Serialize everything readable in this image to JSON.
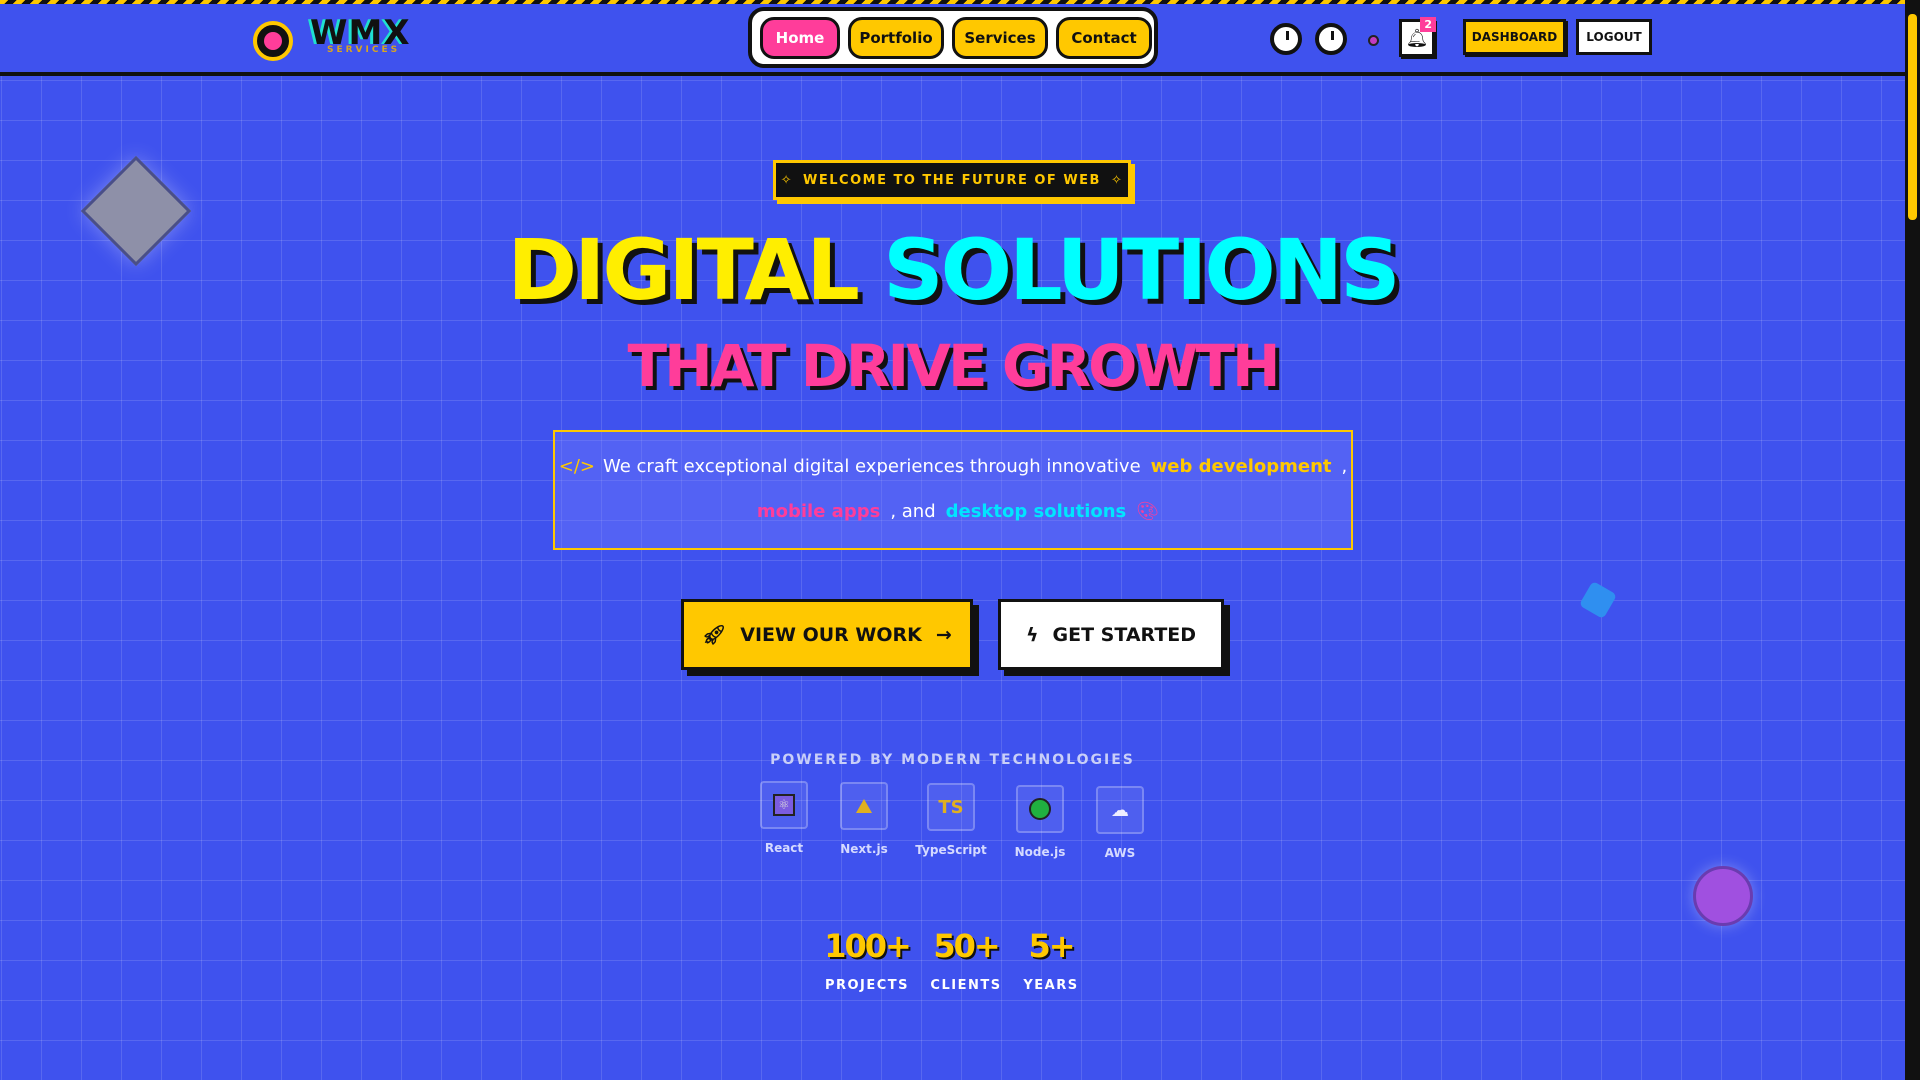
{
  "nav": {
    "logo": "WMX",
    "logo_sub": "SERVICES",
    "links": [
      "Home",
      "Portfolio",
      "Services",
      "Contact"
    ],
    "active": "Home",
    "notifications": "2",
    "dashboard": "DASHBOARD",
    "logout": "LOGOUT"
  },
  "hero": {
    "badge": "WELCOME TO THE FUTURE OF WEB",
    "title_1": "DIGITAL",
    "title_2": "SOLUTIONS",
    "subtitle": "THAT DRIVE GROWTH",
    "desc_pre": "We craft exceptional digital experiences through innovative",
    "desc_h1": "web development",
    "desc_comma": ",",
    "desc_h2": "mobile apps",
    "desc_and": ", and",
    "desc_h3": "desktop solutions",
    "btn_primary": "VIEW OUR WORK",
    "btn_secondary": "GET STARTED"
  },
  "tech": {
    "heading": "POWERED BY MODERN TECHNOLOGIES",
    "items": [
      {
        "label": "React",
        "icon": "react-icon"
      },
      {
        "label": "Next.js",
        "icon": "triangle-icon"
      },
      {
        "label": "TypeScript",
        "icon": "ts-icon",
        "glyph": "TS"
      },
      {
        "label": "Node.js",
        "icon": "green-circle-icon"
      },
      {
        "label": "AWS",
        "icon": "cloud-icon"
      }
    ]
  },
  "stats": [
    {
      "value": "100+",
      "label": "PROJECTS"
    },
    {
      "value": "50+",
      "label": "CLIENTS"
    },
    {
      "value": "5+",
      "label": "YEARS"
    }
  ],
  "colors": {
    "background": "#3f52ee",
    "yellow": "#ffc800",
    "pink": "#ff3d9a",
    "cyan": "#00ffff"
  }
}
